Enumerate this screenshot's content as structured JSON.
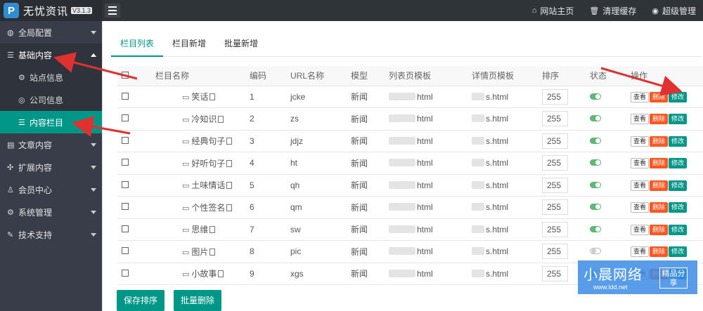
{
  "app": {
    "title": "无忧资讯",
    "version": "V3.1.3"
  },
  "topbar": {
    "links": [
      {
        "icon": "home-icon",
        "glyph": "⌂",
        "label": "网站主页"
      },
      {
        "icon": "trash-icon",
        "glyph": "🗑",
        "label": "清理缓存"
      },
      {
        "icon": "user-icon",
        "glyph": "◉",
        "label": "超级管理"
      }
    ]
  },
  "sidebar": {
    "items": [
      {
        "label": "全局配置",
        "glyph": "◍"
      },
      {
        "label": "基础内容",
        "glyph": "☰"
      },
      {
        "label": "文章内容",
        "glyph": "▤"
      },
      {
        "label": "扩展内容",
        "glyph": "✣"
      },
      {
        "label": "会员中心",
        "glyph": "♙"
      },
      {
        "label": "系统管理",
        "glyph": "⚙"
      },
      {
        "label": "技术支持",
        "glyph": "✎"
      }
    ],
    "sub_items": [
      {
        "label": "站点信息",
        "glyph": "⚙"
      },
      {
        "label": "公司信息",
        "glyph": "◎"
      },
      {
        "label": "内容栏目",
        "glyph": "☰"
      }
    ]
  },
  "tabs": [
    "栏目列表",
    "栏目新增",
    "批量新增"
  ],
  "table": {
    "headers": [
      "栏目名称",
      "编码",
      "URL名称",
      "模型",
      "列表页模板",
      "详情页模板",
      "排序",
      "状态",
      "操作"
    ],
    "rows": [
      {
        "name": "笑话",
        "code": "1",
        "url": "jcke",
        "model": "新闻",
        "list_tpl": "html",
        "detail_tpl": "s.html",
        "sort": "255",
        "status": "on"
      },
      {
        "name": "冷知识",
        "code": "2",
        "url": "zs",
        "model": "新闻",
        "list_tpl": "html",
        "detail_tpl": "s.html",
        "sort": "255",
        "status": "on"
      },
      {
        "name": "经典句子",
        "code": "3",
        "url": "jdjz",
        "model": "新闻",
        "list_tpl": "html",
        "detail_tpl": "s.html",
        "sort": "255",
        "status": "on"
      },
      {
        "name": "好听句子",
        "code": "4",
        "url": "ht",
        "model": "新闻",
        "list_tpl": "html",
        "detail_tpl": "s.html",
        "sort": "255",
        "status": "on"
      },
      {
        "name": "土味情话",
        "code": "5",
        "url": "qh",
        "model": "新闻",
        "list_tpl": "html",
        "detail_tpl": "s.html",
        "sort": "255",
        "status": "on"
      },
      {
        "name": "个性签名",
        "code": "6",
        "url": "qm",
        "model": "新闻",
        "list_tpl": "html",
        "detail_tpl": "s.html",
        "sort": "255",
        "status": "on"
      },
      {
        "name": "思维",
        "code": "7",
        "url": "sw",
        "model": "新闻",
        "list_tpl": "html",
        "detail_tpl": "s.html",
        "sort": "255",
        "status": "on"
      },
      {
        "name": "图片",
        "code": "8",
        "url": "pic",
        "model": "新闻",
        "list_tpl": "html",
        "detail_tpl": "s.html",
        "sort": "255",
        "status": "off"
      },
      {
        "name": "小故事",
        "code": "9",
        "url": "xgs",
        "model": "新闻",
        "list_tpl": "html",
        "detail_tpl": "s.html",
        "sort": "255",
        "status": "on"
      }
    ],
    "actions": {
      "view": "查看",
      "delete": "删除",
      "edit": "修改"
    }
  },
  "footer": {
    "save_sort": "保存排序",
    "batch_delete": "批量删除"
  },
  "watermark": {
    "title": "小晨网络",
    "url": "www.ldd.net",
    "badge": "精品分享"
  },
  "colors": {
    "accent": "#009688",
    "danger": "#ff5722",
    "sidebar": "#393d49",
    "topbar": "#2f3439",
    "arrow": "#e03030"
  }
}
